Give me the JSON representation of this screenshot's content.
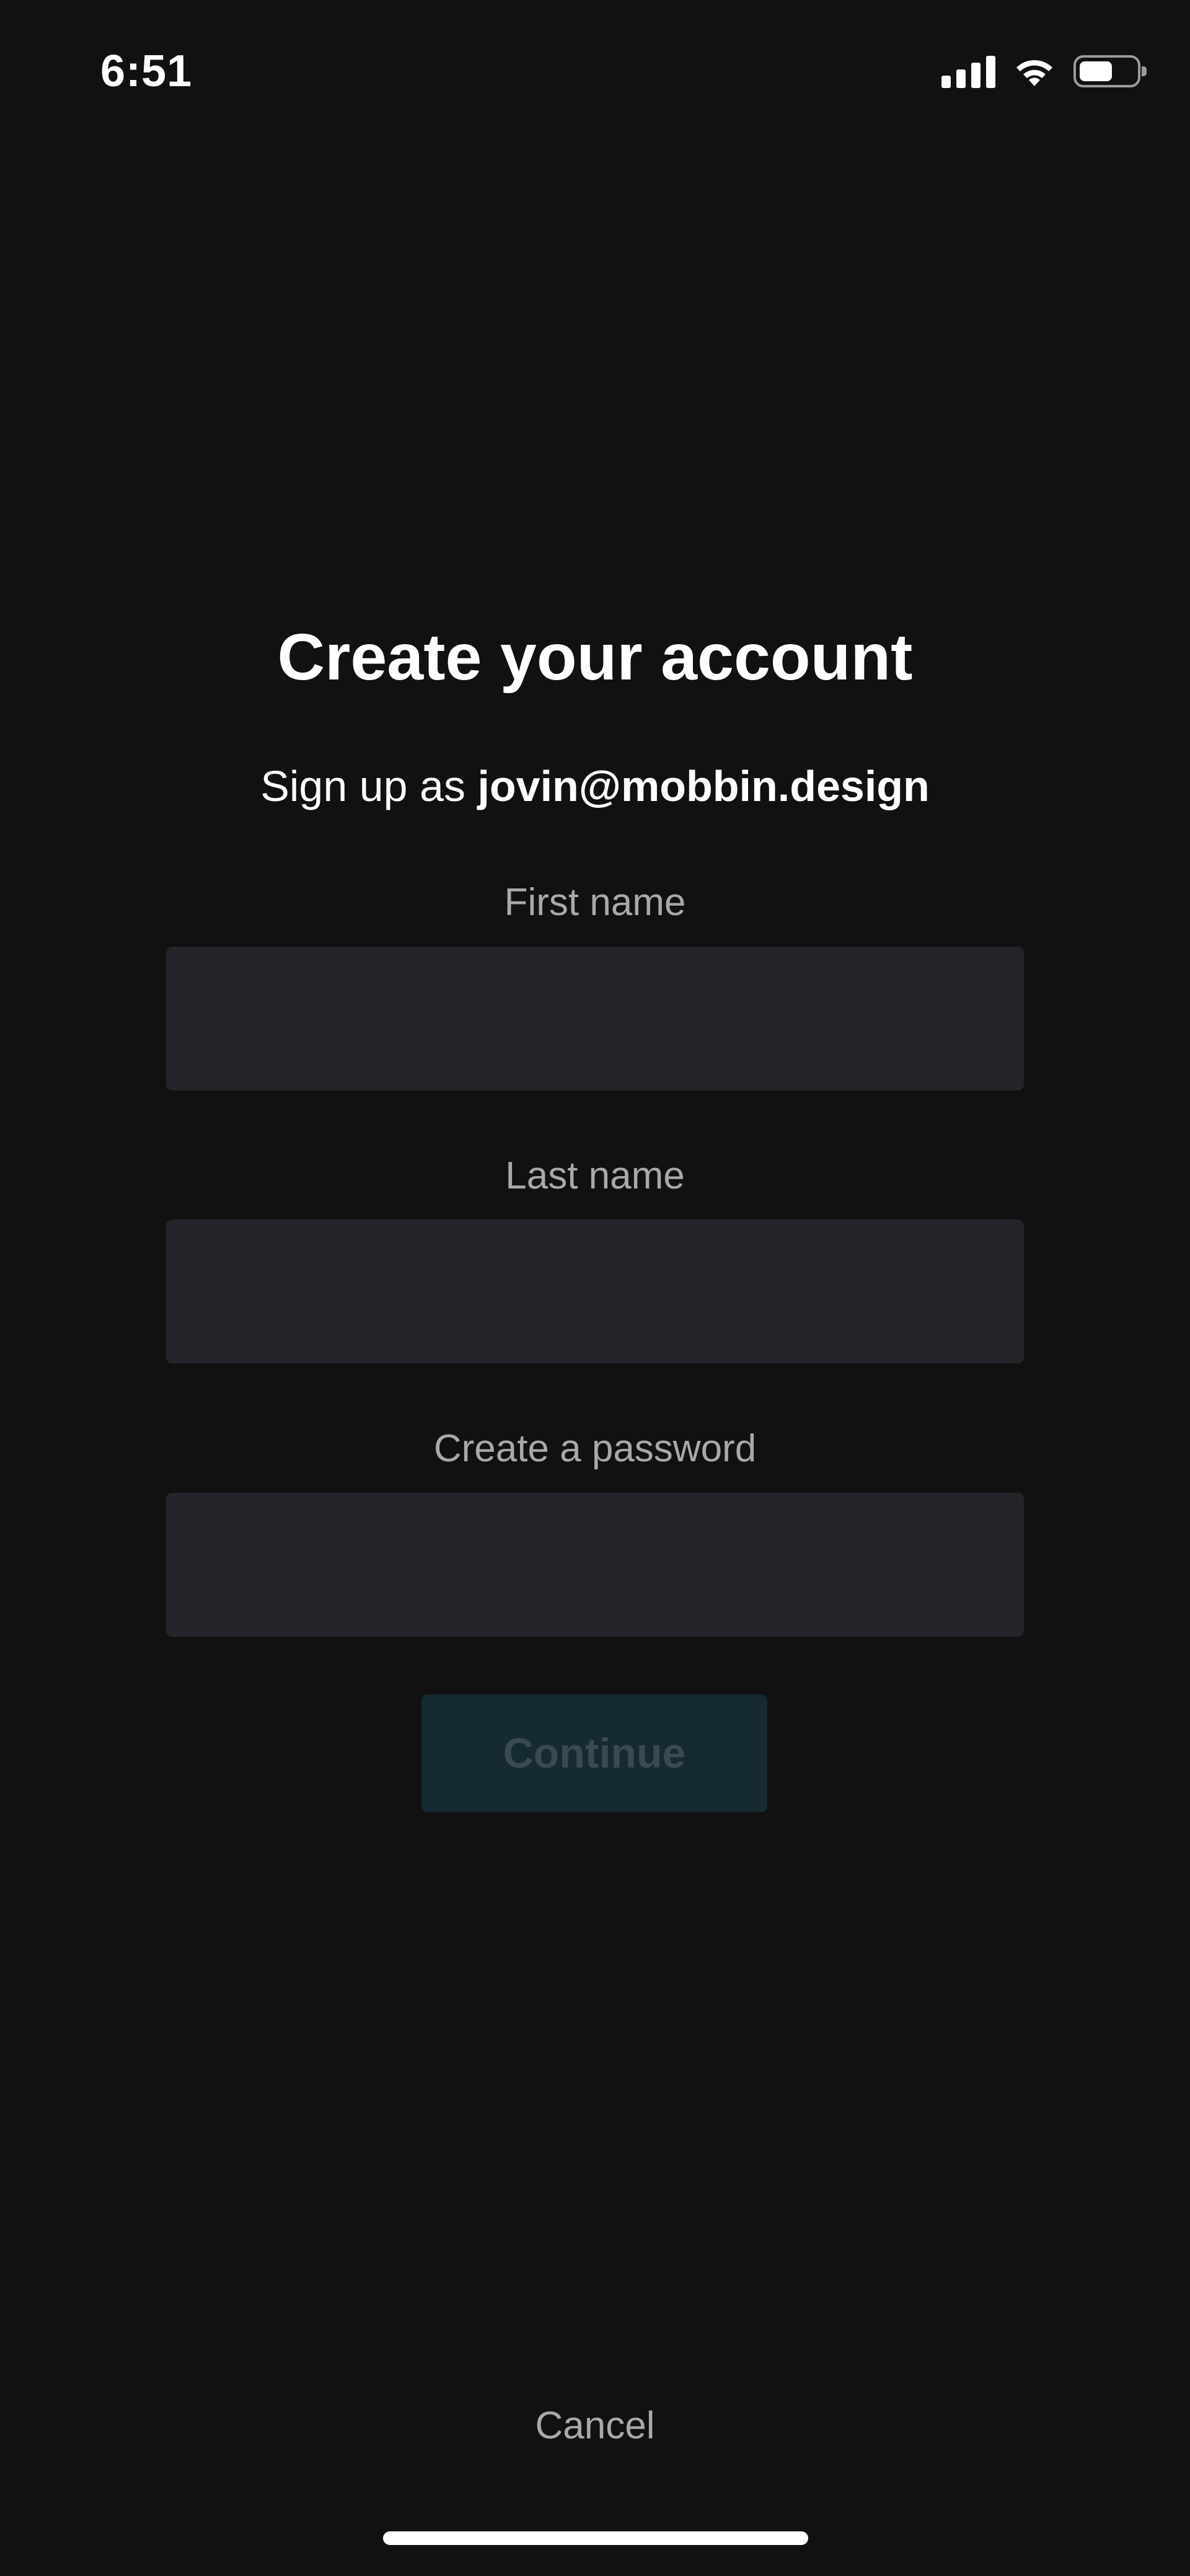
{
  "status_bar": {
    "time": "6:51",
    "icons": [
      "signal-icon",
      "wifi-icon",
      "battery-icon"
    ]
  },
  "form": {
    "title": "Create your account",
    "subtitle_prefix": "Sign up as ",
    "email": "jovin@mobbin.design",
    "fields": [
      {
        "label": "First name",
        "value": "",
        "placeholder": ""
      },
      {
        "label": "Last name",
        "value": "",
        "placeholder": ""
      },
      {
        "label": "Create a password",
        "value": "",
        "placeholder": ""
      }
    ],
    "continue_label": "Continue",
    "cancel_label": "Cancel"
  },
  "colors": {
    "background": "#111112",
    "input_background": "#24252b",
    "label_text": "#a9a9ad",
    "continue_button_disabled": "#152a33",
    "continue_text_disabled": "#3b4a52"
  }
}
